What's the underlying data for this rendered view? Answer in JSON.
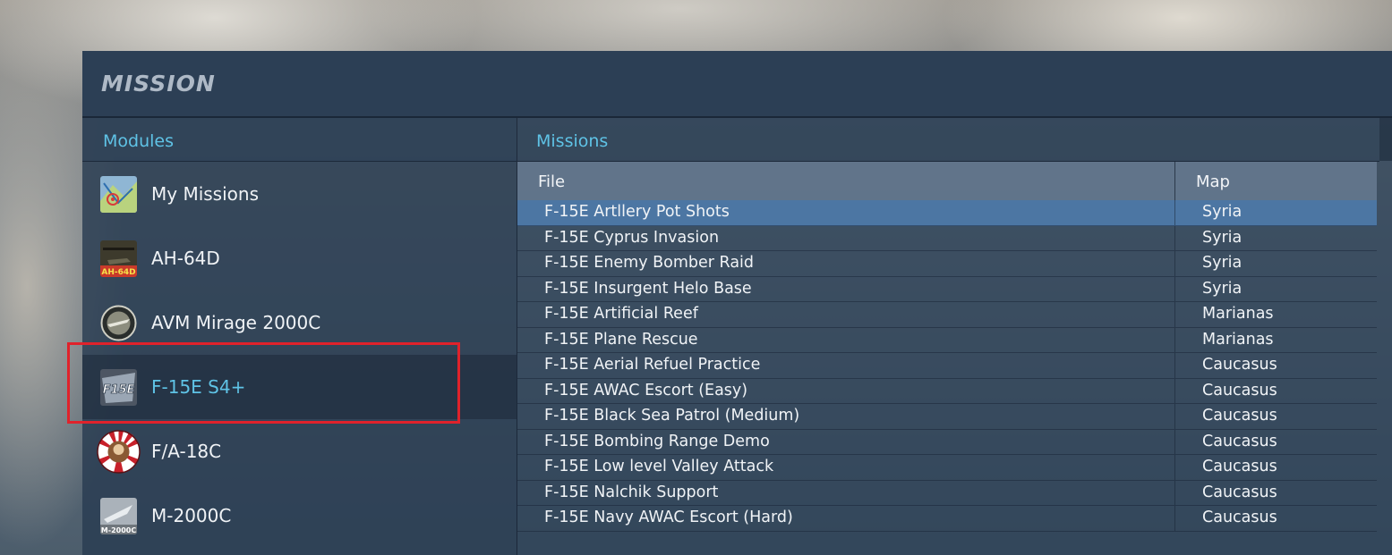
{
  "window": {
    "title": "MISSION"
  },
  "modules": {
    "header": "Modules",
    "items": [
      {
        "label": "My Missions",
        "icon": "map-icon"
      },
      {
        "label": "AH-64D",
        "icon": "ah64d-icon",
        "icon_text": "AH-64D"
      },
      {
        "label": "AVM Mirage 2000C",
        "icon": "mirage-emblem-icon"
      },
      {
        "label": "F-15E S4+",
        "icon": "f15e-icon",
        "icon_text": "F15E",
        "selected": true
      },
      {
        "label": "F/A-18C",
        "icon": "fa18c-roundel-icon"
      },
      {
        "label": "M-2000C",
        "icon": "m2000c-icon",
        "icon_text": "M-2000C"
      }
    ]
  },
  "missions": {
    "header": "Missions",
    "columns": {
      "file": "File",
      "map": "Map"
    },
    "rows": [
      {
        "file": "F-15E Artllery Pot Shots",
        "map": "Syria",
        "selected": true
      },
      {
        "file": "F-15E Cyprus Invasion",
        "map": "Syria"
      },
      {
        "file": "F-15E Enemy Bomber Raid",
        "map": "Syria"
      },
      {
        "file": "F-15E Insurgent Helo Base",
        "map": "Syria"
      },
      {
        "file": "F-15E Artificial Reef",
        "map": "Marianas"
      },
      {
        "file": "F-15E Plane Rescue",
        "map": "Marianas"
      },
      {
        "file": "F-15E Aerial Refuel Practice",
        "map": "Caucasus"
      },
      {
        "file": "F-15E AWAC Escort (Easy)",
        "map": "Caucasus"
      },
      {
        "file": "F-15E Black Sea Patrol (Medium)",
        "map": "Caucasus"
      },
      {
        "file": "F-15E Bombing Range Demo",
        "map": "Caucasus"
      },
      {
        "file": "F-15E Low level Valley Attack",
        "map": "Caucasus"
      },
      {
        "file": "F-15E Nalchik Support",
        "map": "Caucasus"
      },
      {
        "file": "F-15E Navy AWAC Escort (Hard)",
        "map": "Caucasus"
      }
    ]
  },
  "colors": {
    "accent": "#5fc3e6",
    "selected_row": "#4c76a3",
    "highlight_box": "#e0222b"
  }
}
